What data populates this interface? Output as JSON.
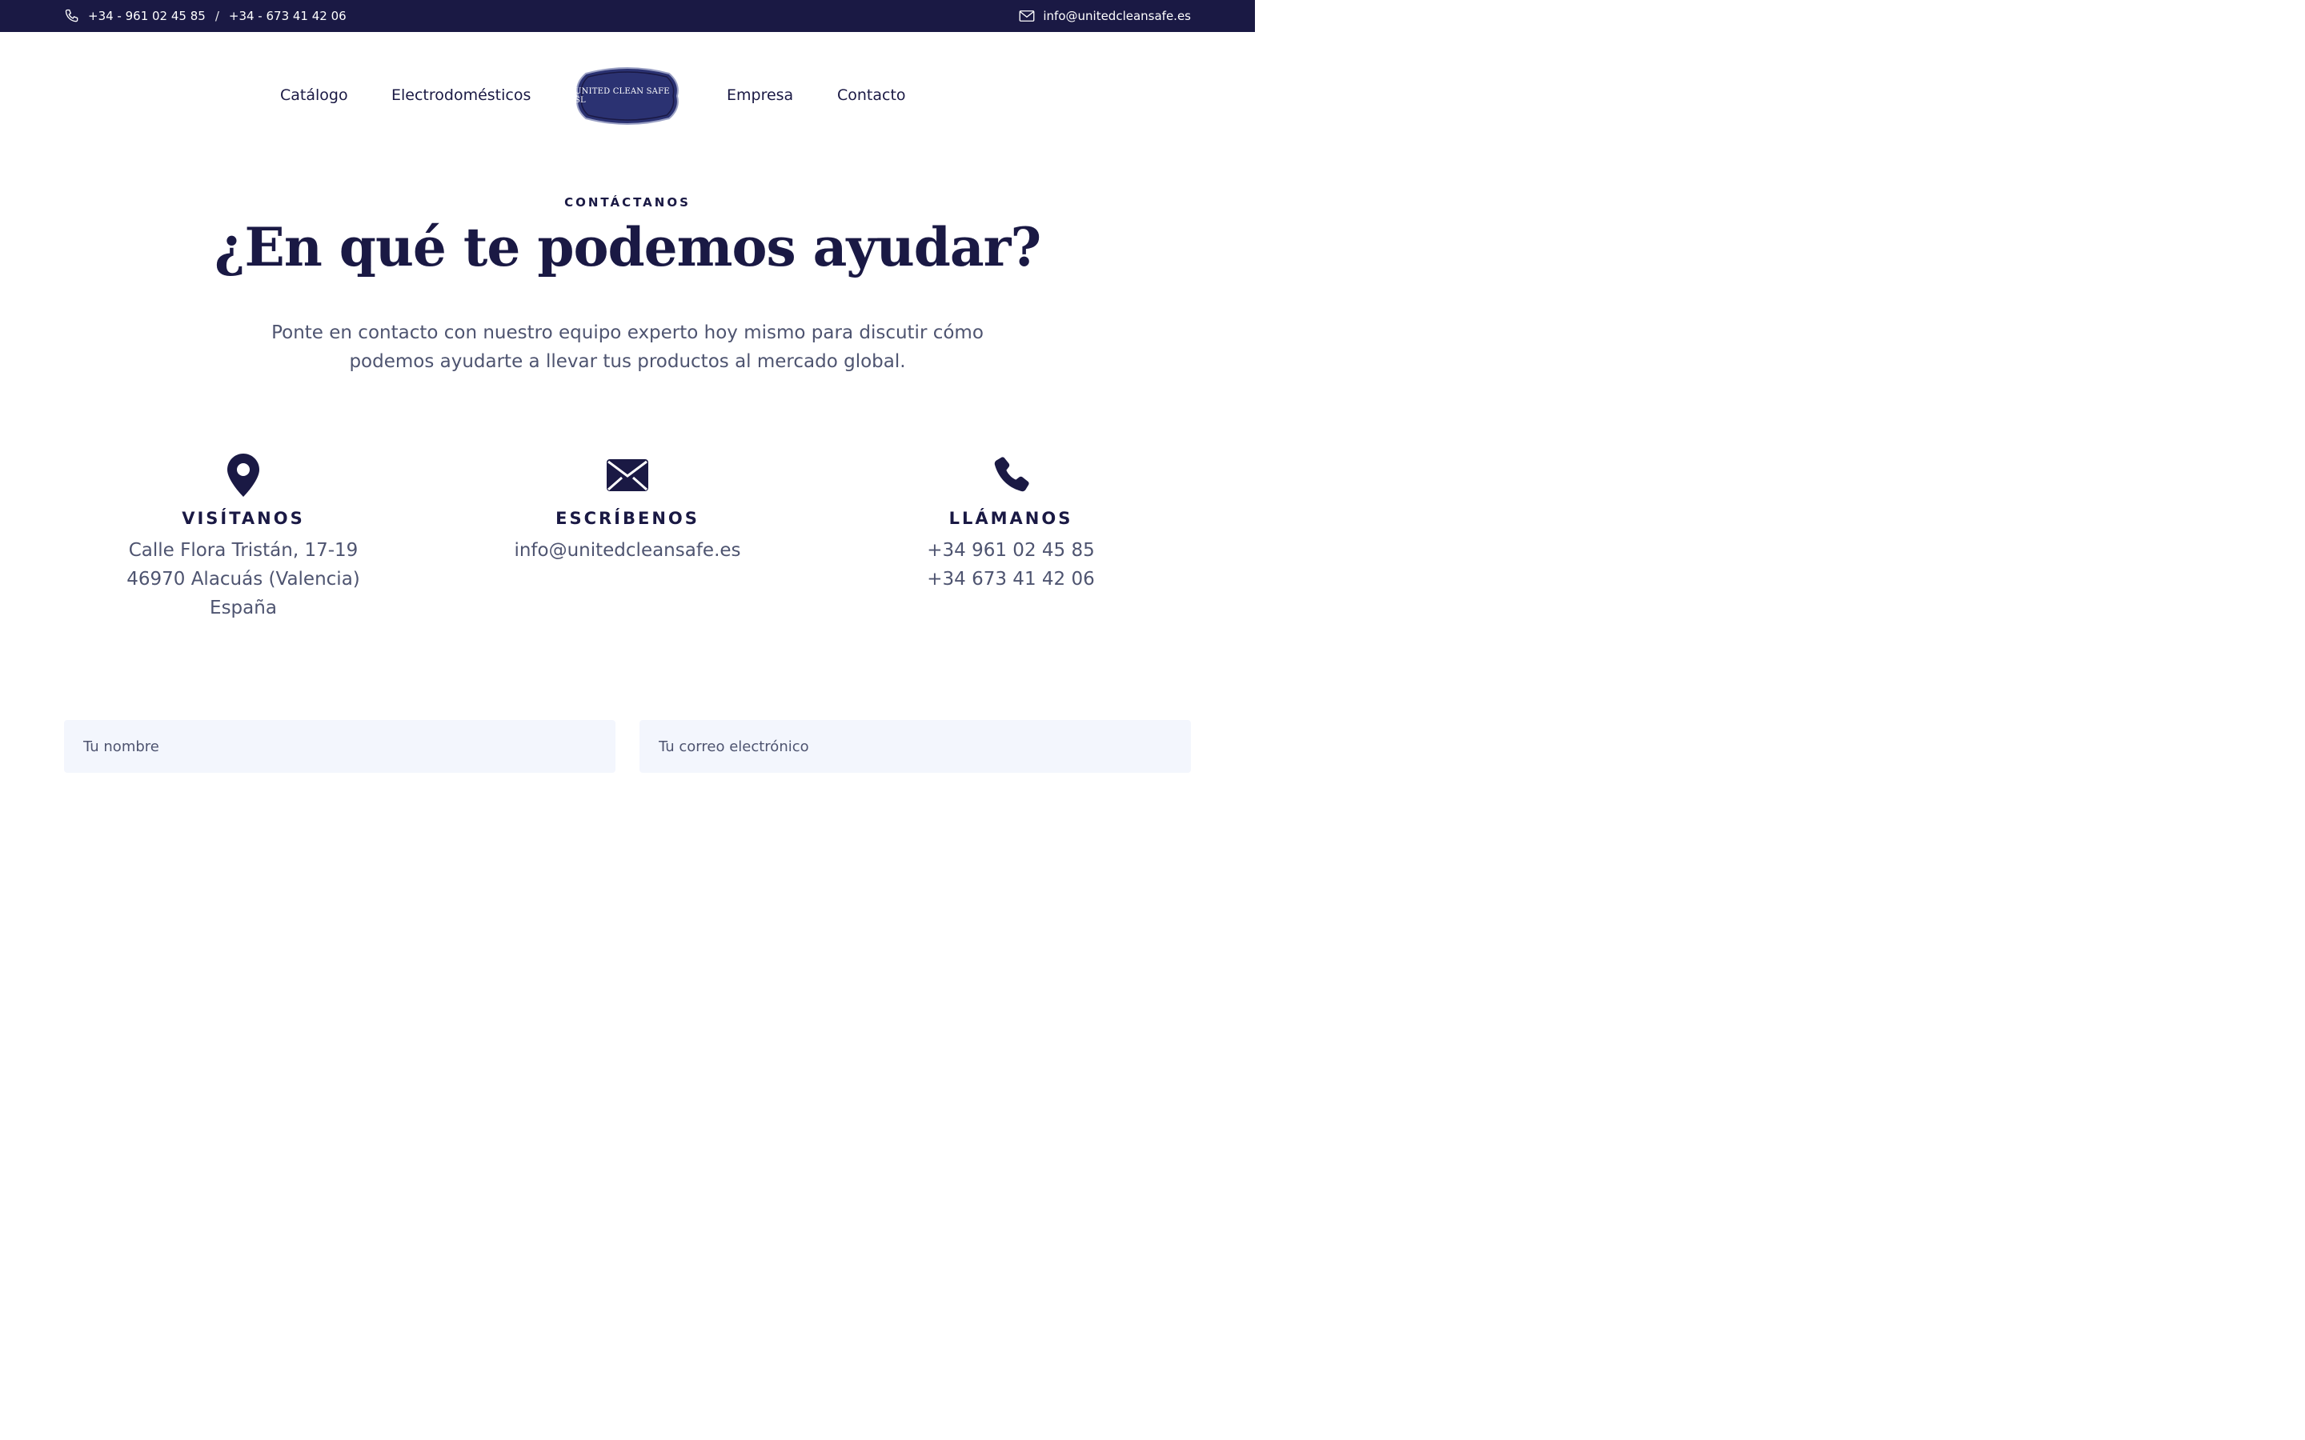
{
  "topbar": {
    "phone1": "+34 - 961 02 45 85",
    "separator": "/",
    "phone2": "+34 - 673 41 42 06",
    "email": "info@unitedcleansafe.es"
  },
  "nav": {
    "items": [
      "Catálogo",
      "Electrodomésticos",
      "Empresa",
      "Contacto"
    ],
    "logo_text": "UNITED CLEAN SAFE SL"
  },
  "hero": {
    "eyebrow": "CONTÁCTANOS",
    "title": "¿En qué te podemos ayudar?",
    "subtitle": "Ponte en contacto con nuestro equipo experto hoy mismo para discutir cómo podemos ayudarte a llevar tus productos al mercado global."
  },
  "cards": [
    {
      "icon": "map-pin-icon",
      "title": "VISÍTANOS",
      "lines": [
        "Calle Flora Tristán, 17-19",
        "46970 Alacuás (Valencia)",
        "España"
      ]
    },
    {
      "icon": "envelope-icon",
      "title": "ESCRÍBENOS",
      "lines": [
        "info@unitedcleansafe.es"
      ]
    },
    {
      "icon": "phone-icon",
      "title": "LLÁMANOS",
      "lines": [
        "+34 961 02 45 85",
        "+34 673 41 42 06"
      ]
    }
  ],
  "form": {
    "name_placeholder": "Tu nombre",
    "email_placeholder": "Tu correo electrónico"
  },
  "colors": {
    "navy": "#1a1944",
    "text_muted": "#4e5470",
    "field_bg": "#f3f6fd",
    "logo_fill": "#2b3272"
  }
}
